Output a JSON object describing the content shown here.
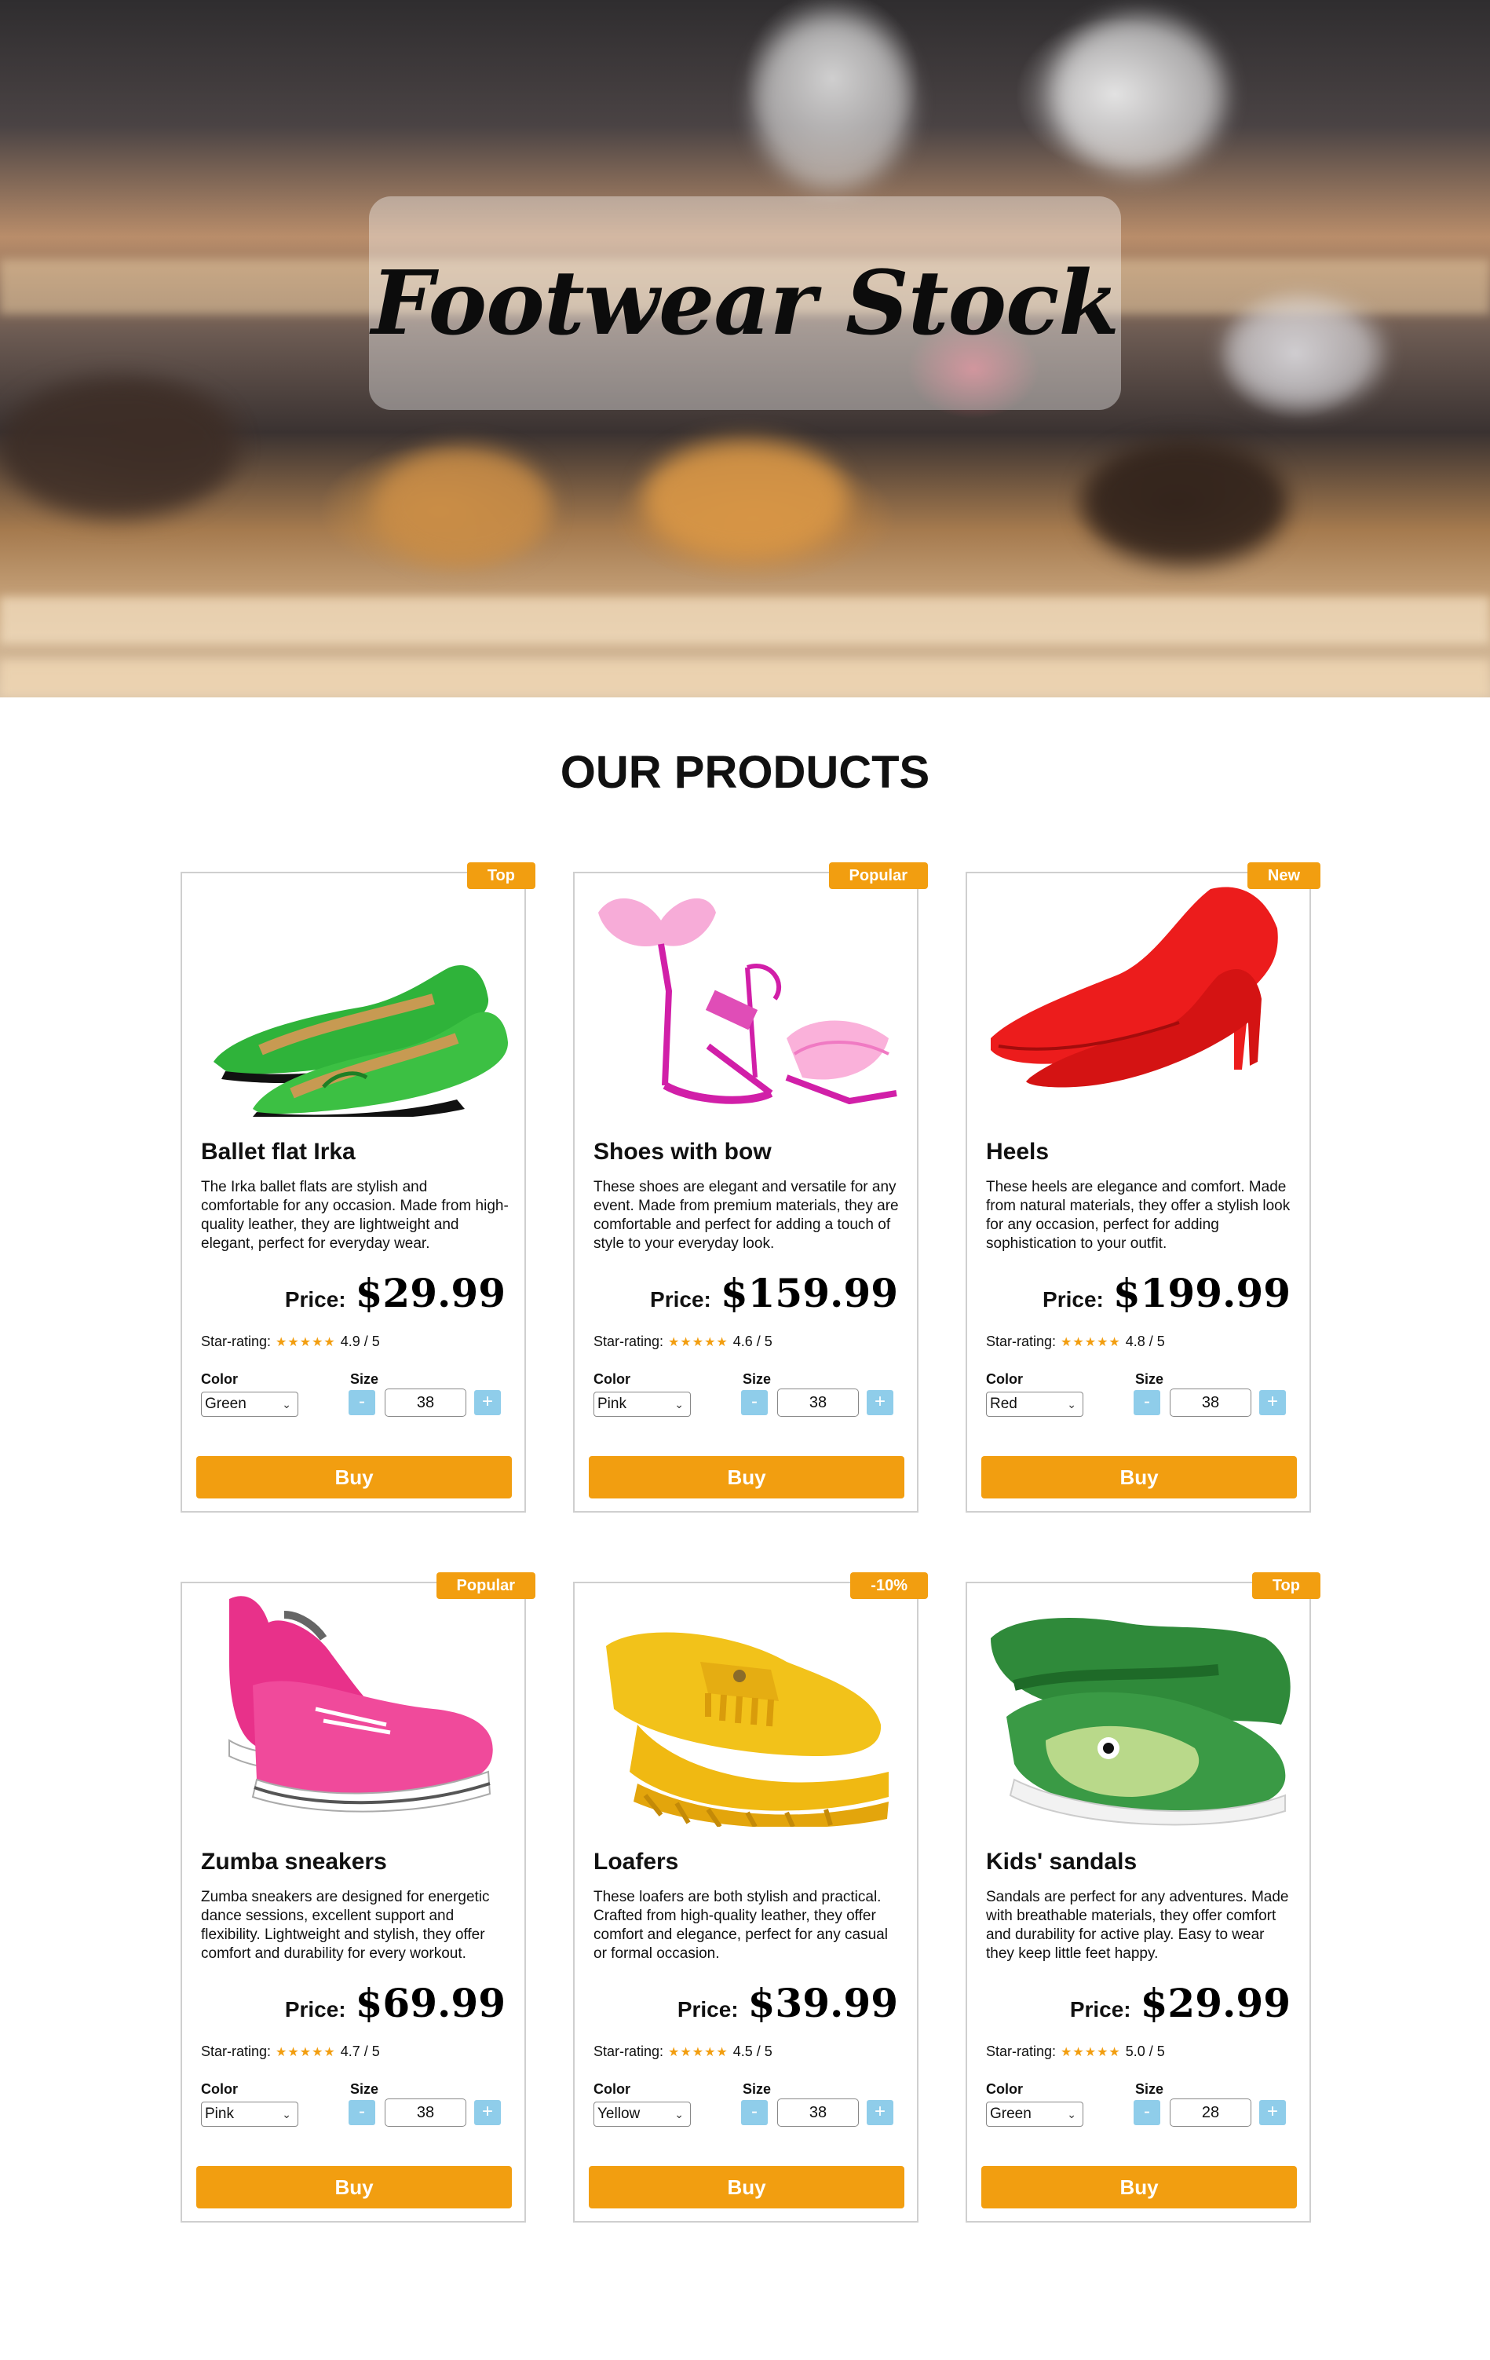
{
  "hero": {
    "title": "Footwear Stock"
  },
  "section": {
    "title": "OUR PRODUCTS"
  },
  "labels": {
    "price": "Price:",
    "star_rating": "Star-rating:",
    "color": "Color",
    "size": "Size",
    "minus": "-",
    "plus": "+",
    "buy": "Buy",
    "stars": "★★★★★"
  },
  "colors": {
    "accent": "#f29e10",
    "stepper": "#8fcdea",
    "stars": "#f29e10"
  },
  "products": [
    {
      "badge": "Top",
      "name": "Ballet flat Irka",
      "desc": "The Irka ballet flats are stylish and comfortable for any occasion. Made from high-quality leather, they are lightweight and elegant, perfect for everyday wear.",
      "price": "$29.99",
      "rating": "4.9 / 5",
      "color": "Green",
      "size": "38",
      "image": "green-ballet-flats"
    },
    {
      "badge": "Popular",
      "name": "Shoes with bow",
      "desc": "These shoes are elegant and versatile for any event. Made from premium materials, they are comfortable and perfect for adding a touch of style to your everyday look.",
      "price": "$159.99",
      "rating": "4.6 / 5",
      "color": "Pink",
      "size": "38",
      "image": "pink-bow-heels"
    },
    {
      "badge": "New",
      "name": "Heels",
      "desc": "These heels are elegance and comfort. Made from natural materials, they offer a stylish look for any occasion, perfect for adding sophistication to your outfit.",
      "price": "$199.99",
      "rating": "4.8 / 5",
      "color": "Red",
      "size": "38",
      "image": "red-heels"
    },
    {
      "badge": "Popular",
      "name": "Zumba sneakers",
      "desc": "Zumba sneakers are designed for energetic dance sessions, excellent support and flexibility. Lightweight and stylish, they offer comfort and durability for every workout.",
      "price": "$69.99",
      "rating": "4.7 / 5",
      "color": "Pink",
      "size": "38",
      "image": "pink-sneakers"
    },
    {
      "badge": "-10%",
      "name": "Loafers",
      "desc": "These loafers are both stylish and practical. Crafted from high-quality leather, they offer comfort and elegance, perfect for any casual or formal occasion.",
      "price": "$39.99",
      "rating": "4.5 / 5",
      "color": "Yellow",
      "size": "38",
      "image": "yellow-loafers"
    },
    {
      "badge": "Top",
      "name": "Kids' sandals",
      "desc": "Sandals are perfect for any adventures. Made with breathable materials, they offer comfort and durability for active play. Easy to wear they keep little feet happy.",
      "price": "$29.99",
      "rating": "5.0 / 5",
      "color": "Green",
      "size": "28",
      "image": "green-kids-sandals"
    }
  ]
}
